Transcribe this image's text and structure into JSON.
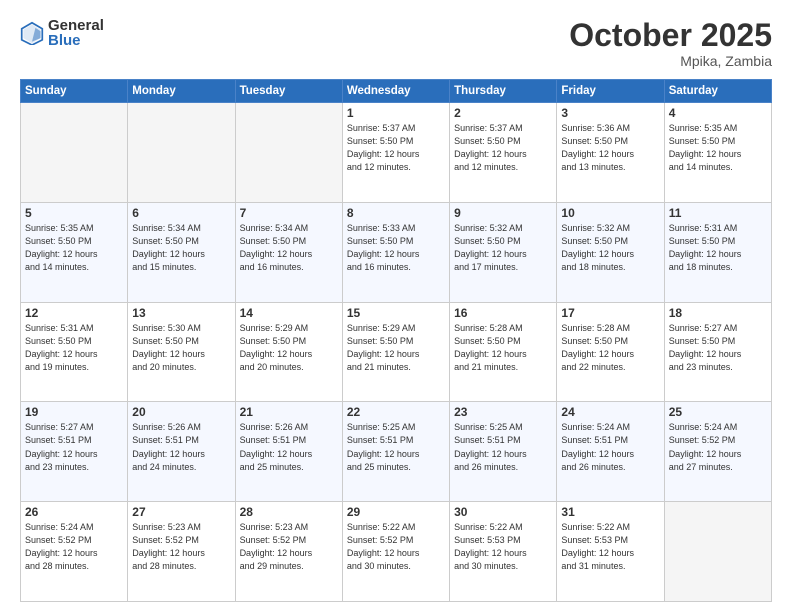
{
  "logo": {
    "general": "General",
    "blue": "Blue"
  },
  "header": {
    "month": "October 2025",
    "location": "Mpika, Zambia"
  },
  "days_of_week": [
    "Sunday",
    "Monday",
    "Tuesday",
    "Wednesday",
    "Thursday",
    "Friday",
    "Saturday"
  ],
  "weeks": [
    [
      {
        "day": "",
        "info": ""
      },
      {
        "day": "",
        "info": ""
      },
      {
        "day": "",
        "info": ""
      },
      {
        "day": "1",
        "info": "Sunrise: 5:37 AM\nSunset: 5:50 PM\nDaylight: 12 hours\nand 12 minutes."
      },
      {
        "day": "2",
        "info": "Sunrise: 5:37 AM\nSunset: 5:50 PM\nDaylight: 12 hours\nand 12 minutes."
      },
      {
        "day": "3",
        "info": "Sunrise: 5:36 AM\nSunset: 5:50 PM\nDaylight: 12 hours\nand 13 minutes."
      },
      {
        "day": "4",
        "info": "Sunrise: 5:35 AM\nSunset: 5:50 PM\nDaylight: 12 hours\nand 14 minutes."
      }
    ],
    [
      {
        "day": "5",
        "info": "Sunrise: 5:35 AM\nSunset: 5:50 PM\nDaylight: 12 hours\nand 14 minutes."
      },
      {
        "day": "6",
        "info": "Sunrise: 5:34 AM\nSunset: 5:50 PM\nDaylight: 12 hours\nand 15 minutes."
      },
      {
        "day": "7",
        "info": "Sunrise: 5:34 AM\nSunset: 5:50 PM\nDaylight: 12 hours\nand 16 minutes."
      },
      {
        "day": "8",
        "info": "Sunrise: 5:33 AM\nSunset: 5:50 PM\nDaylight: 12 hours\nand 16 minutes."
      },
      {
        "day": "9",
        "info": "Sunrise: 5:32 AM\nSunset: 5:50 PM\nDaylight: 12 hours\nand 17 minutes."
      },
      {
        "day": "10",
        "info": "Sunrise: 5:32 AM\nSunset: 5:50 PM\nDaylight: 12 hours\nand 18 minutes."
      },
      {
        "day": "11",
        "info": "Sunrise: 5:31 AM\nSunset: 5:50 PM\nDaylight: 12 hours\nand 18 minutes."
      }
    ],
    [
      {
        "day": "12",
        "info": "Sunrise: 5:31 AM\nSunset: 5:50 PM\nDaylight: 12 hours\nand 19 minutes."
      },
      {
        "day": "13",
        "info": "Sunrise: 5:30 AM\nSunset: 5:50 PM\nDaylight: 12 hours\nand 20 minutes."
      },
      {
        "day": "14",
        "info": "Sunrise: 5:29 AM\nSunset: 5:50 PM\nDaylight: 12 hours\nand 20 minutes."
      },
      {
        "day": "15",
        "info": "Sunrise: 5:29 AM\nSunset: 5:50 PM\nDaylight: 12 hours\nand 21 minutes."
      },
      {
        "day": "16",
        "info": "Sunrise: 5:28 AM\nSunset: 5:50 PM\nDaylight: 12 hours\nand 21 minutes."
      },
      {
        "day": "17",
        "info": "Sunrise: 5:28 AM\nSunset: 5:50 PM\nDaylight: 12 hours\nand 22 minutes."
      },
      {
        "day": "18",
        "info": "Sunrise: 5:27 AM\nSunset: 5:50 PM\nDaylight: 12 hours\nand 23 minutes."
      }
    ],
    [
      {
        "day": "19",
        "info": "Sunrise: 5:27 AM\nSunset: 5:51 PM\nDaylight: 12 hours\nand 23 minutes."
      },
      {
        "day": "20",
        "info": "Sunrise: 5:26 AM\nSunset: 5:51 PM\nDaylight: 12 hours\nand 24 minutes."
      },
      {
        "day": "21",
        "info": "Sunrise: 5:26 AM\nSunset: 5:51 PM\nDaylight: 12 hours\nand 25 minutes."
      },
      {
        "day": "22",
        "info": "Sunrise: 5:25 AM\nSunset: 5:51 PM\nDaylight: 12 hours\nand 25 minutes."
      },
      {
        "day": "23",
        "info": "Sunrise: 5:25 AM\nSunset: 5:51 PM\nDaylight: 12 hours\nand 26 minutes."
      },
      {
        "day": "24",
        "info": "Sunrise: 5:24 AM\nSunset: 5:51 PM\nDaylight: 12 hours\nand 26 minutes."
      },
      {
        "day": "25",
        "info": "Sunrise: 5:24 AM\nSunset: 5:52 PM\nDaylight: 12 hours\nand 27 minutes."
      }
    ],
    [
      {
        "day": "26",
        "info": "Sunrise: 5:24 AM\nSunset: 5:52 PM\nDaylight: 12 hours\nand 28 minutes."
      },
      {
        "day": "27",
        "info": "Sunrise: 5:23 AM\nSunset: 5:52 PM\nDaylight: 12 hours\nand 28 minutes."
      },
      {
        "day": "28",
        "info": "Sunrise: 5:23 AM\nSunset: 5:52 PM\nDaylight: 12 hours\nand 29 minutes."
      },
      {
        "day": "29",
        "info": "Sunrise: 5:22 AM\nSunset: 5:52 PM\nDaylight: 12 hours\nand 30 minutes."
      },
      {
        "day": "30",
        "info": "Sunrise: 5:22 AM\nSunset: 5:53 PM\nDaylight: 12 hours\nand 30 minutes."
      },
      {
        "day": "31",
        "info": "Sunrise: 5:22 AM\nSunset: 5:53 PM\nDaylight: 12 hours\nand 31 minutes."
      },
      {
        "day": "",
        "info": ""
      }
    ]
  ]
}
